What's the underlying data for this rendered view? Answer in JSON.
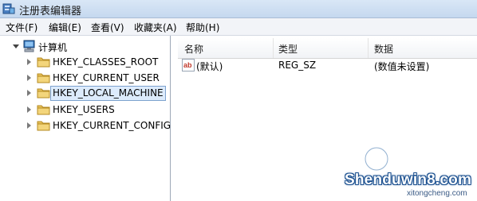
{
  "window": {
    "title": "注册表编辑器"
  },
  "menu": [
    "文件(F)",
    "编辑(E)",
    "查看(V)",
    "收藏夹(A)",
    "帮助(H)"
  ],
  "tree": {
    "root": {
      "label": "计算机",
      "icon": "computer-icon"
    },
    "items": [
      {
        "label": "HKEY_CLASSES_ROOT",
        "selected": false
      },
      {
        "label": "HKEY_CURRENT_USER",
        "selected": false
      },
      {
        "label": "HKEY_LOCAL_MACHINE",
        "selected": true
      },
      {
        "label": "HKEY_USERS",
        "selected": false
      },
      {
        "label": "HKEY_CURRENT_CONFIG",
        "selected": false
      }
    ]
  },
  "values": {
    "columns": [
      "名称",
      "类型",
      "数据"
    ],
    "rows": [
      {
        "name": "(默认)",
        "type": "REG_SZ",
        "data": "(数值未设置)",
        "icon": "ab-string-icon"
      }
    ]
  },
  "watermark": {
    "main": "Shenduwin8.com",
    "sub": "xitongcheng.com"
  },
  "colors": {
    "titlebar": "#c5d8ef",
    "selection": "#dcebfc",
    "folder": "#e8c25a"
  }
}
